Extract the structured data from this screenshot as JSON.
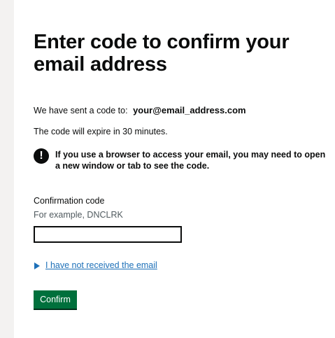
{
  "page": {
    "title": "Enter code to confirm your email address",
    "sent_prefix": "We have sent a code to:",
    "email": "your@email_address.com",
    "expiry": "The code will expire in 30 minutes.",
    "warning_icon": "!",
    "warning_text": "If you use a browser to access your email, you may need to open a new window or tab to see the code."
  },
  "form": {
    "label": "Confirmation code",
    "hint": "For example, DNCLRK",
    "value": "",
    "details_link": "I have not received the email",
    "confirm_label": "Confirm"
  },
  "colors": {
    "link": "#1d70b8",
    "button": "#00703c",
    "text": "#0b0c0c",
    "page_background": "#f3f2f1"
  }
}
